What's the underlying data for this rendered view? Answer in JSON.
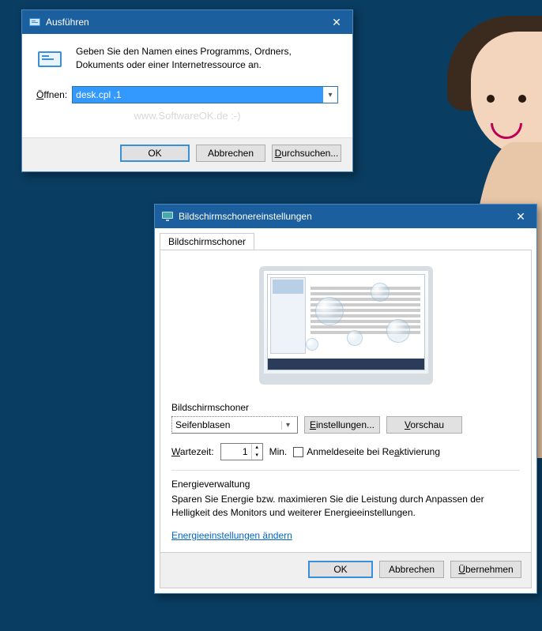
{
  "run": {
    "title": "Ausführen",
    "desc": "Geben Sie den Namen eines Programms, Ordners, Dokuments oder einer Internetressource an.",
    "open_label": "Öffnen:",
    "value": "desk.cpl ,1",
    "watermark": "www.SoftwareOK.de :-)",
    "ok": "OK",
    "cancel": "Abbrechen",
    "browse": "Durchsuchen..."
  },
  "sss": {
    "title": "Bildschirmschonereinstellungen",
    "tab": "Bildschirmschoner",
    "group": "Bildschirmschoner",
    "saver": "Seifenblasen",
    "settings": "Einstellungen...",
    "preview": "Vorschau",
    "wait_label": "Wartezeit:",
    "wait_value": "1",
    "wait_unit": "Min.",
    "logon_chk": "Anmeldeseite bei Reaktivierung",
    "energy_head": "Energieverwaltung",
    "energy_text": "Sparen Sie Energie bzw. maximieren Sie die Leistung durch Anpassen der Helligkeit des Monitors und weiterer Energieeinstellungen.",
    "energy_link": "Energieeinstellungen ändern",
    "ok": "OK",
    "cancel": "Abbrechen",
    "apply": "Übernehmen"
  }
}
